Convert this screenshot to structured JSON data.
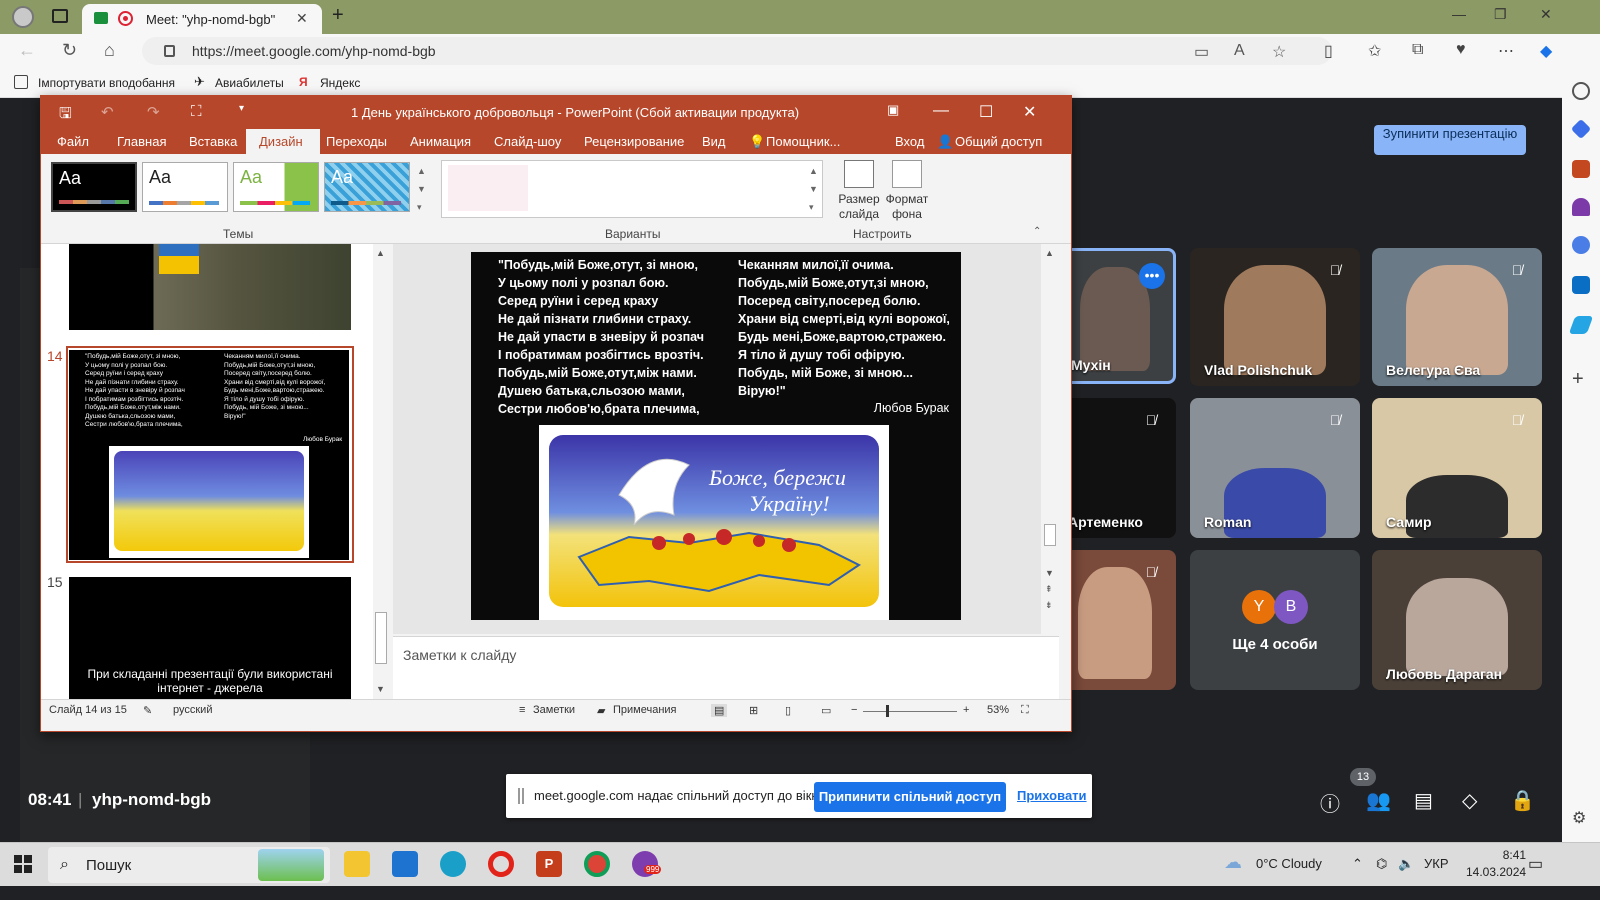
{
  "browser": {
    "tab_title": "Meet: \"yhp-nomd-bgb\"",
    "url": "https://meet.google.com/yhp-nomd-bgb",
    "bookmarks": [
      "Імпортувати вподобання",
      "Авиабилеты",
      "Яндекс"
    ]
  },
  "ppt": {
    "window_title": "1 День українського добровольця - PowerPoint (Сбой активации продукта)",
    "menu": [
      "Файл",
      "Главная",
      "Вставка",
      "Дизайн",
      "Переходы",
      "Анимация",
      "Слайд-шоу",
      "Рецензирование",
      "Вид",
      "Помощник...",
      "Вход",
      "Общий доступ"
    ],
    "ribbon": {
      "themes_label": "Темы",
      "variants_label": "Варианты",
      "customize_label": "Настроить",
      "theme_sample": "Aa",
      "slide_size_label": "Размер слайда",
      "format_bg_label": "Формат фона"
    },
    "thumbs": {
      "active_number": "14",
      "next_number": "15",
      "next_slide_text": "При складанні презентації були використані інтернет - джерела"
    },
    "slide": {
      "poem_left": "\"Побудь,мій Боже,отут, зі мною,\nУ цьому полі у розпал бою.\nСеред руїни і серед краху\nНе дай пізнати глибини страху.\nНе дай упасти в зневіру й розпач\nІ побратимам розбігтись врозтіч.\nПобудь,мій Боже,отут,між нами.\nДушею батька,сльозою мами,\nСестри любов'ю,брата плечима,",
      "poem_right": "Чеканням милої,її очима.\nПобудь,мій Боже,отут,зі мною,\nПосеред світу,посеред болю.\nХрани від смерті,від кулі ворожої,\nБудь мені,Боже,вартою,стражею.\nЯ тіло й душу тобі офірую.\nПобудь, мій Боже, зі мною...\nВірую!\"",
      "author": "Любов Бурак",
      "image_caption_1": "Боже, бережи",
      "image_caption_2": "Україну!"
    },
    "notes_placeholder": "Заметки к слайду",
    "status": {
      "slide_info": "Слайд 14 из 15",
      "language": "русский",
      "notes_btn": "Заметки",
      "comments_btn": "Примечания",
      "zoom": "53%"
    }
  },
  "meet": {
    "stop_presenting": "Зупинити презентацію",
    "time": "08:41",
    "meeting_code": "yhp-nomd-bgb",
    "participants_count": "13",
    "participants": [
      {
        "name": "Мухін",
        "muted": false,
        "highlight": true
      },
      {
        "name": "Vlad Polishchuk",
        "muted": true
      },
      {
        "name": "Велегура Єва",
        "muted": true
      },
      {
        "name": "Артеменко",
        "muted": true
      },
      {
        "name": "Roman",
        "muted": true
      },
      {
        "name": "Самир",
        "muted": true
      },
      {
        "name": "",
        "muted": true
      },
      {
        "name": "Ще 4 особи",
        "muted": false
      },
      {
        "name": "Любовь Дараган",
        "muted": false
      }
    ],
    "others_avatars": [
      "Y",
      "B"
    ],
    "share_notice": "meet.google.com надає спільний доступ до вікна.",
    "share_stop": "Припинити спільний доступ",
    "share_hide": "Приховати"
  },
  "taskbar": {
    "search_placeholder": "Пошук",
    "weather": "0°C Cloudy",
    "lang": "УКР",
    "time": "8:41",
    "date": "14.03.2024",
    "viber_badge": "999"
  }
}
